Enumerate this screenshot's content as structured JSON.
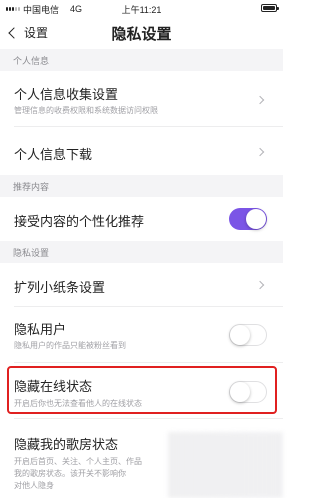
{
  "status_bar": {
    "carrier": "中国电信",
    "network": "4G",
    "time": "上午11:21"
  },
  "nav": {
    "back_label": "设置",
    "title": "隐私设置"
  },
  "sections": {
    "personal_info": "个人信息",
    "recommend": "推荐内容",
    "privacy": "隐私设置"
  },
  "rows": {
    "info_collect": {
      "title": "个人信息收集设置",
      "subtitle": "管理信息的收费权限和系统数据访问权限"
    },
    "info_download": {
      "title": "个人信息下载"
    },
    "personalized": {
      "title": "接受内容的个性化推荐",
      "toggle": "on"
    },
    "note_settings": {
      "title": "扩列小纸条设置"
    },
    "private_user": {
      "title": "隐私用户",
      "subtitle": "隐私用户的作品只能被粉丝看到",
      "toggle": "off"
    },
    "hide_online": {
      "title": "隐藏在线状态",
      "subtitle": "开启后你也无法查看他人的在线状态",
      "toggle": "off"
    },
    "hide_karaoke": {
      "title": "隐藏我的歌房状态",
      "subtitle_lines": [
        "开启后首页、关注、个人主页、作品",
        "我的歌房状态。该开关不影响你",
        "对他人隐身"
      ]
    }
  },
  "colors": {
    "accent": "#7b55e6",
    "highlight": "#e02020",
    "section_bg": "#f4f4f6"
  }
}
